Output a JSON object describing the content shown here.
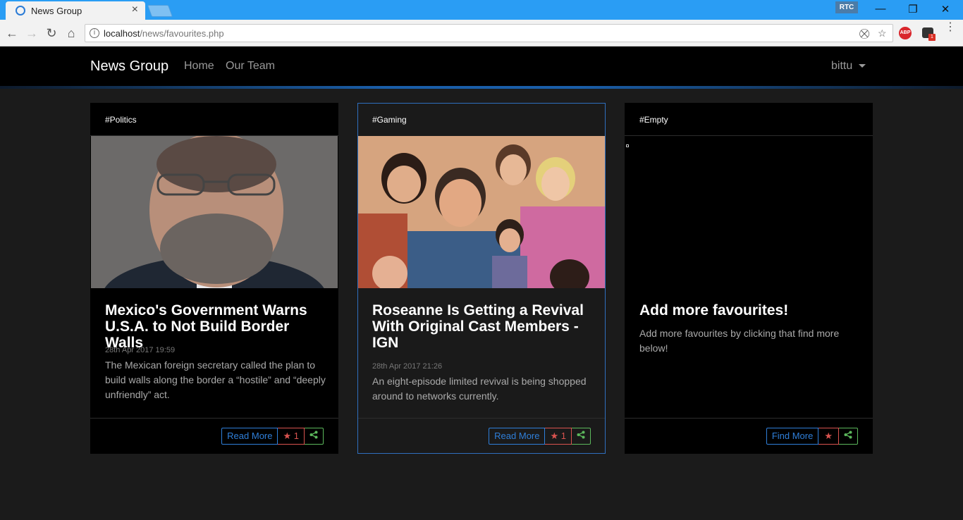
{
  "browser": {
    "tab_title": "News Group",
    "tab_close": "×",
    "rtc_label": "RTC",
    "url_host": "localhost",
    "url_path": "/news/favourites.php",
    "window": {
      "minimize": "—",
      "restore": "❐",
      "close": "✕"
    },
    "back": "←",
    "forward": "→",
    "reload": "↻",
    "home": "⌂",
    "abp_label": "ABP",
    "ext_badge": "1",
    "menu": "⋮"
  },
  "nav": {
    "brand": "News Group",
    "links": [
      "Home",
      "Our Team"
    ],
    "user": "bittu"
  },
  "cards": [
    {
      "tag": "#Politics",
      "title": "Mexico's Government Warns U.S.A. to Not Build Border Walls",
      "date": "28th Apr 2017 19:59",
      "text": "The Mexican foreign secretary called the plan to build walls along the border a “hostile” and “deeply unfriendly” act.",
      "button": "Read More",
      "fav_count": "1"
    },
    {
      "tag": "#Gaming",
      "title": "Roseanne Is Getting a Revival With Original Cast Members - IGN",
      "date": "28th Apr 2017 21:26",
      "text": "An eight-episode limited revival is being shopped around to networks currently.",
      "button": "Read More",
      "fav_count": "1"
    },
    {
      "tag": "#Empty",
      "title": "Add more favourites!",
      "date": "",
      "text": "Add more favourites by clicking that find more below!",
      "button": "Find More",
      "fav_count": ""
    }
  ],
  "icons": {
    "star": "★",
    "share": "share-icon"
  },
  "colors": {
    "accent": "#2f7fd9",
    "fav": "#d9534f",
    "share": "#5cb85c",
    "chrome_blue": "#2a9df4"
  }
}
